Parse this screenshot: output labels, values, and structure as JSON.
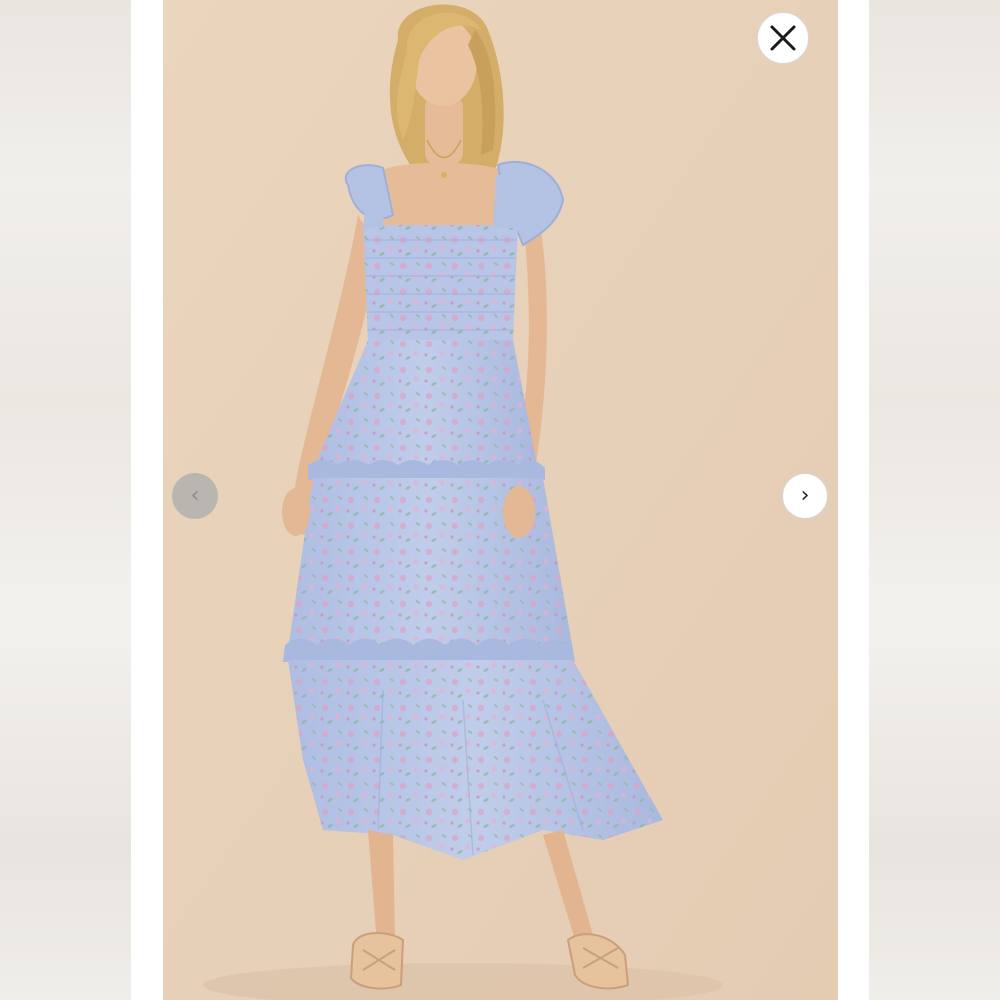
{
  "viewer": {
    "close_icon": "close-icon",
    "prev_icon": "chevron-left-icon",
    "next_icon": "chevron-right-icon",
    "prev_glyph": "‹",
    "next_glyph": "›"
  },
  "photo": {
    "subject": "product-photo",
    "colors": {
      "backdrop": "#e9d3bb",
      "dress": "#b9c6e6",
      "dress_shadow": "#a5b3d8",
      "floral_pink": "#d9a0c4",
      "floral_green": "#8fb39f",
      "skin": "#e8bf9c",
      "hair": "#d9b46e"
    }
  }
}
